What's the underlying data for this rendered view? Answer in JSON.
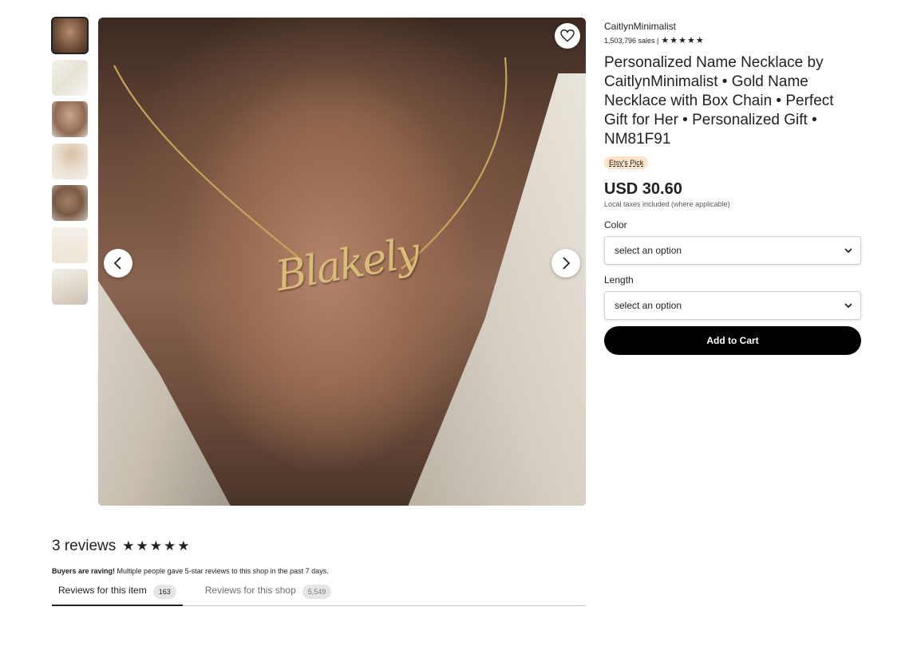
{
  "thumbnails": [
    {
      "icon": "thumbnail-0",
      "active": true
    },
    {
      "icon": "thumbnail-1"
    },
    {
      "icon": "thumbnail-2"
    },
    {
      "icon": "thumbnail-3"
    },
    {
      "icon": "thumbnail-4"
    },
    {
      "icon": "thumbnail-5"
    },
    {
      "icon": "thumbnail-6"
    }
  ],
  "gallery": {
    "necklace_text": "Blakely",
    "prev_icon": "chevron-left-icon",
    "next_icon": "chevron-right-icon",
    "favorite_icon": "heart-icon"
  },
  "product": {
    "shop_name": "CaitlynMinimalist",
    "sales": "1,503,796 sales |",
    "shop_stars": "★★★★★",
    "title": "Personalized Name Necklace by CaitlynMinimalist • Gold Name Necklace with Box Chain • Perfect Gift for Her • Personalized Gift • NM81F91",
    "badge": "Etsy's Pick",
    "price": "USD 30.60",
    "tax_note": "Local taxes included (where applicable)",
    "color_label": "Color",
    "color_value": "select an option",
    "length_label": "Length",
    "length_value": "select an option",
    "add_to_cart": "Add to Cart"
  },
  "reviews": {
    "count_text": "3 reviews",
    "stars": "★★★★★",
    "raving_bold": "Buyers are raving!",
    "raving_text": " Multiple people gave 5-star reviews to this shop in the past 7 days.",
    "tabs": [
      {
        "label": "Reviews for this item",
        "count": "163",
        "active": true
      },
      {
        "label": "Reviews for this shop",
        "count": "5,549",
        "active": false
      }
    ]
  },
  "colors": {
    "button": "#000000",
    "badge_bg": "#fde4c8"
  }
}
